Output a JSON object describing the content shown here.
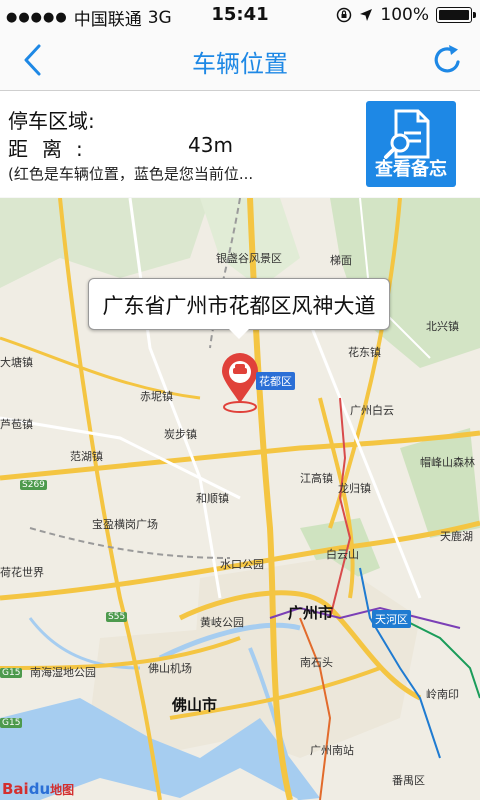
{
  "status_bar": {
    "carrier": "中国联通",
    "network": "3G",
    "time": "15:41",
    "battery": "100%"
  },
  "nav": {
    "title": "车辆位置",
    "back_icon": "chevron-left-icon",
    "refresh_icon": "refresh-icon"
  },
  "info": {
    "parking_area_label": "停车区域:",
    "distance_label": "距离:",
    "distance_value": "43m",
    "hint": "(红色是车辆位置，蓝色是您当前位...",
    "memo_button": "查看备忘"
  },
  "map": {
    "callout": "广东省广州市花都区风神大道",
    "labels": {
      "baiyun_fengjing": "银盏谷风景区",
      "tixia": "梯面",
      "beixing": "北兴镇",
      "datang": "大塘镇",
      "huadong": "花东镇",
      "chini": "赤坭镇",
      "guangzhou_baiyun": "广州白云",
      "tanbu": "炭步镇",
      "qiaotou": "芦苞镇",
      "fanhu": "范湖镇",
      "jianggao": "江高镇",
      "longgui": "龙归镇",
      "maofeng": "帽峰山森林",
      "heshun": "和顺镇",
      "baoying": "宝盈横岗广场",
      "tianlu": "天鹿湖",
      "shuikou": "水口公园",
      "baiyunshan": "白云山",
      "heyuan": "荷花世界",
      "huangqi": "黄岐公园",
      "nanhai": "南海湿地公园",
      "foshan_airport": "佛山机场",
      "nanshitou": "南石头",
      "lingnan": "岭南印",
      "guangzhou_south": "广州南站",
      "panyu": "番禺区"
    },
    "cities": {
      "guangzhou": "广州市",
      "foshan": "佛山市",
      "huadu": "花都区",
      "tianhe": "天河区"
    },
    "highways": [
      "S269",
      "G15",
      "S55",
      "G15"
    ],
    "logo": "Bai",
    "logo_du": "du",
    "logo_suffix": "地图"
  }
}
